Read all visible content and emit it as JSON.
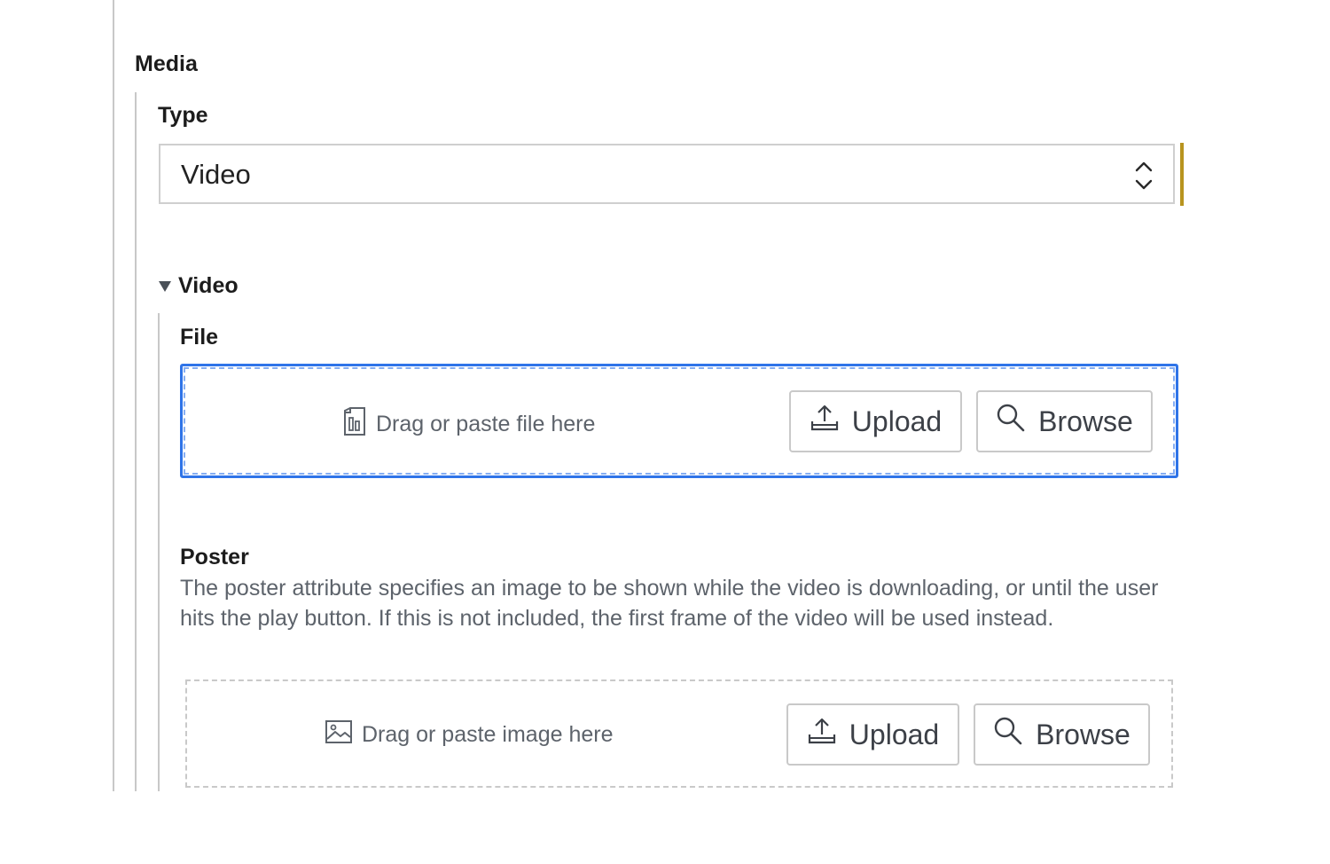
{
  "media": {
    "section_label": "Media",
    "type_field": {
      "label": "Type",
      "selected_value": "Video"
    },
    "video_group": {
      "disclosure_label": "Video",
      "expanded": true,
      "file_field": {
        "label": "File",
        "dropzone_hint": "Drag or paste file here",
        "upload_label": "Upload",
        "browse_label": "Browse"
      },
      "poster_field": {
        "label": "Poster",
        "description": "The poster attribute specifies an image to be shown while the video is downloading, or until the user hits the play button. If this is not included, the first frame of the video will be used instead.",
        "dropzone_hint": "Drag or paste image here",
        "upload_label": "Upload",
        "browse_label": "Browse"
      }
    }
  },
  "colors": {
    "focus_border": "#2f74e8",
    "accent_bar": "#b8941f",
    "muted_text": "#5d636b"
  },
  "icons": {
    "select_arrows": "chevron-up-down-icon",
    "disclosure": "triangle-down-icon",
    "file_hint": "file-chart-icon",
    "image_hint": "image-icon",
    "upload": "upload-icon",
    "browse": "search-icon"
  }
}
